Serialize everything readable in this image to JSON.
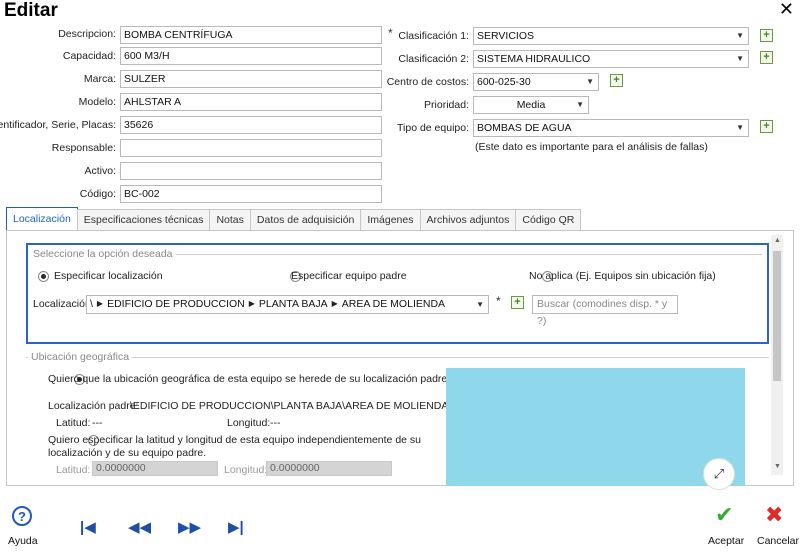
{
  "window": {
    "title": "Editar"
  },
  "form_left": {
    "descripcion": {
      "label": "Descripcion:",
      "value": "BOMBA CENTRÍFUGA"
    },
    "capacidad": {
      "label": "Capacidad:",
      "value": "600 M3/H"
    },
    "marca": {
      "label": "Marca:",
      "value": "SULZER"
    },
    "modelo": {
      "label": "Modelo:",
      "value": "AHLSTAR A"
    },
    "identificador": {
      "label": "Identificador, Serie, Placas:",
      "value": "35626"
    },
    "responsable": {
      "label": "Responsable:",
      "value": ""
    },
    "activo": {
      "label": "Activo:",
      "value": ""
    },
    "codigo": {
      "label": "Código:",
      "value": "BC-002"
    },
    "required_mark": "*"
  },
  "form_right": {
    "clasificacion1": {
      "label": "Clasificación 1:",
      "value": "SERVICIOS"
    },
    "clasificacion2": {
      "label": "Clasificación 2:",
      "value": "SISTEMA HIDRAULICO"
    },
    "centro_costos": {
      "label": "Centro de costos:",
      "value": "600-025-30"
    },
    "prioridad": {
      "label": "Prioridad:",
      "value": "Media"
    },
    "tipo_equipo": {
      "label": "Tipo de equipo:",
      "value": "BOMBAS DE AGUA"
    },
    "tipo_note": "(Este dato es importante para el análisis de fallas)"
  },
  "tabs": [
    {
      "label": "Localización"
    },
    {
      "label": "Especificaciones técnicas"
    },
    {
      "label": "Notas"
    },
    {
      "label": "Datos de adquisición"
    },
    {
      "label": "Imágenes"
    },
    {
      "label": "Archivos adjuntos"
    },
    {
      "label": "Código QR"
    }
  ],
  "location_group": {
    "title": "Seleccione la opción deseada",
    "options": [
      {
        "label": "Especificar localización",
        "selected": true
      },
      {
        "label": "Especificar equipo padre",
        "selected": false
      },
      {
        "label": "No aplica (Ej. Equipos sin ubicación fija)",
        "selected": false
      }
    ],
    "localizacion_label": "Localización:",
    "path": [
      "\\",
      "EDIFICIO DE PRODUCCION",
      "PLANTA BAJA",
      "AREA DE MOLIENDA"
    ],
    "required_mark": "*",
    "search_placeholder": "Buscar (comodines disp. * y ?)"
  },
  "geo_group": {
    "title": "Ubicación geográfica",
    "option_inherit": "Quiero que la ubicación geográfica de esta equipo se herede de su localización padre.",
    "parent_label": "Localización padre:",
    "parent_value": "\\EDIFICIO DE PRODUCCION\\PLANTA BAJA\\AREA DE MOLIENDA",
    "lat_label": "Latitud:",
    "lat_value": "---",
    "lon_label": "Longitud:",
    "lon_value": "---",
    "option_custom": "Quiero especificar la latitud y longitud de esta equipo independientemente de su localización y de su equipo padre.",
    "lat_input_label": "Latitud:",
    "lat_input_value": "0.0000000",
    "lon_input_label": "Longitud:",
    "lon_input_value": "0.0000000"
  },
  "footer": {
    "help_label": "Ayuda",
    "accept_label": "Aceptar",
    "cancel_label": "Cancelar"
  },
  "icons": {
    "close": "close-icon",
    "add": "add-item-icon",
    "dropdown": "chevron-down-icon",
    "nav_first": "first-record-icon",
    "nav_prev": "previous-record-icon",
    "nav_next": "next-record-icon",
    "nav_last": "last-record-icon",
    "help": "help-icon",
    "accept": "checkmark-icon",
    "cancel": "cancel-x-icon"
  },
  "colors": {
    "accent_blue": "#2b63c6",
    "accept_green": "#3aa836",
    "cancel_red": "#dd2b2b",
    "map_water": "#8fd8ec"
  }
}
